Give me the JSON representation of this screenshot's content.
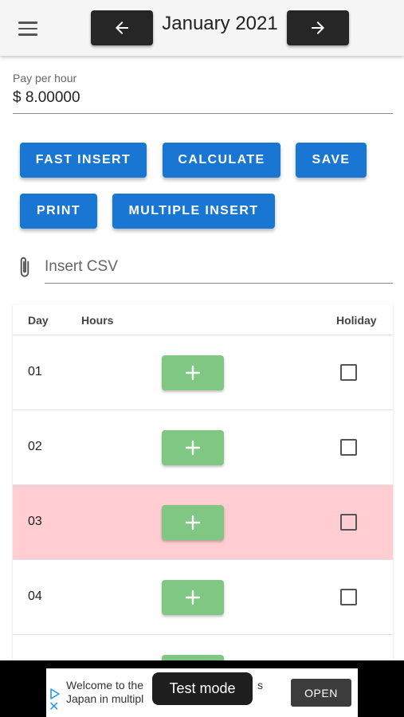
{
  "header": {
    "month_title": "January 2021",
    "menu_icon": "hamburger-menu-icon",
    "prev_icon": "arrow-left-icon",
    "next_icon": "arrow-right-icon"
  },
  "pay": {
    "label": "Pay per hour",
    "value": "$ 8.00000"
  },
  "actions": {
    "fast_insert": "FAST INSERT",
    "calculate": "CALCULATE",
    "save": "SAVE",
    "print": "PRINT",
    "multiple_insert": "MULTIPLE INSERT"
  },
  "csv": {
    "placeholder": "Insert CSV",
    "icon": "paperclip-icon"
  },
  "table": {
    "columns": {
      "day": "Day",
      "hours": "Hours",
      "holiday": "Holiday"
    },
    "rows": [
      {
        "day": "01",
        "highlighted": false,
        "holiday": false
      },
      {
        "day": "02",
        "highlighted": false,
        "holiday": false
      },
      {
        "day": "03",
        "highlighted": true,
        "holiday": false
      },
      {
        "day": "04",
        "highlighted": false,
        "holiday": false
      }
    ],
    "add_icon": "plus-icon"
  },
  "ad": {
    "line1": "Welcome to the",
    "line2": "Japan in multipl",
    "line1_tail": "s",
    "open_label": "OPEN",
    "toast": "Test mode"
  },
  "colors": {
    "primary": "#1976d2",
    "add_button": "#81c784",
    "highlight_row": "#ffcdd2",
    "nav_button": "#262626"
  }
}
